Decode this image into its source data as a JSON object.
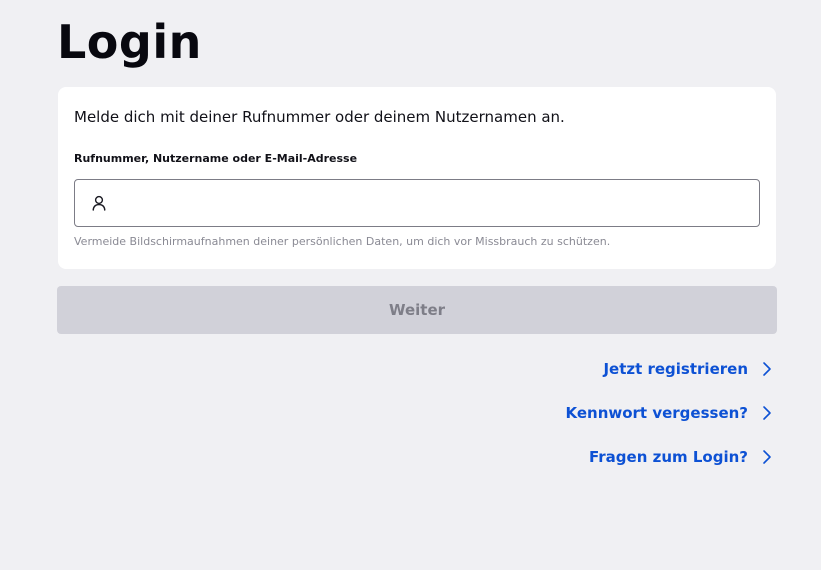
{
  "page": {
    "title": "Login"
  },
  "card": {
    "intro": "Melde dich mit deiner Rufnummer oder deinem Nutzernamen an.",
    "field_label": "Rufnummer, Nutzername oder E-Mail-Adresse",
    "input_value": "",
    "input_icon": "user-icon",
    "hint": "Vermeide Bildschirmaufnahmen deiner persönlichen Daten, um dich vor Missbrauch zu schützen."
  },
  "actions": {
    "next_label": "Weiter",
    "next_disabled": true
  },
  "links": [
    {
      "label": "Jetzt registrieren",
      "icon": "chevron-right-icon"
    },
    {
      "label": "Kennwort vergessen?",
      "icon": "chevron-right-icon"
    },
    {
      "label": "Fragen zum Login?",
      "icon": "chevron-right-icon"
    }
  ],
  "colors": {
    "background": "#f0f0f3",
    "card": "#ffffff",
    "link": "#0d51d4",
    "button_disabled_bg": "#d1d1d9",
    "button_disabled_text": "#7e7e88"
  }
}
